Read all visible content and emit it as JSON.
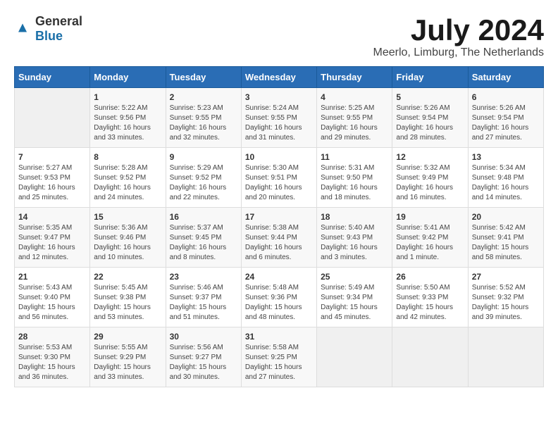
{
  "logo": {
    "text_general": "General",
    "text_blue": "Blue"
  },
  "title": "July 2024",
  "subtitle": "Meerlo, Limburg, The Netherlands",
  "days_of_week": [
    "Sunday",
    "Monday",
    "Tuesday",
    "Wednesday",
    "Thursday",
    "Friday",
    "Saturday"
  ],
  "weeks": [
    [
      {
        "day": "",
        "sunrise": "",
        "sunset": "",
        "daylight": ""
      },
      {
        "day": "1",
        "sunrise": "Sunrise: 5:22 AM",
        "sunset": "Sunset: 9:56 PM",
        "daylight": "Daylight: 16 hours and 33 minutes."
      },
      {
        "day": "2",
        "sunrise": "Sunrise: 5:23 AM",
        "sunset": "Sunset: 9:55 PM",
        "daylight": "Daylight: 16 hours and 32 minutes."
      },
      {
        "day": "3",
        "sunrise": "Sunrise: 5:24 AM",
        "sunset": "Sunset: 9:55 PM",
        "daylight": "Daylight: 16 hours and 31 minutes."
      },
      {
        "day": "4",
        "sunrise": "Sunrise: 5:25 AM",
        "sunset": "Sunset: 9:55 PM",
        "daylight": "Daylight: 16 hours and 29 minutes."
      },
      {
        "day": "5",
        "sunrise": "Sunrise: 5:26 AM",
        "sunset": "Sunset: 9:54 PM",
        "daylight": "Daylight: 16 hours and 28 minutes."
      },
      {
        "day": "6",
        "sunrise": "Sunrise: 5:26 AM",
        "sunset": "Sunset: 9:54 PM",
        "daylight": "Daylight: 16 hours and 27 minutes."
      }
    ],
    [
      {
        "day": "7",
        "sunrise": "Sunrise: 5:27 AM",
        "sunset": "Sunset: 9:53 PM",
        "daylight": "Daylight: 16 hours and 25 minutes."
      },
      {
        "day": "8",
        "sunrise": "Sunrise: 5:28 AM",
        "sunset": "Sunset: 9:52 PM",
        "daylight": "Daylight: 16 hours and 24 minutes."
      },
      {
        "day": "9",
        "sunrise": "Sunrise: 5:29 AM",
        "sunset": "Sunset: 9:52 PM",
        "daylight": "Daylight: 16 hours and 22 minutes."
      },
      {
        "day": "10",
        "sunrise": "Sunrise: 5:30 AM",
        "sunset": "Sunset: 9:51 PM",
        "daylight": "Daylight: 16 hours and 20 minutes."
      },
      {
        "day": "11",
        "sunrise": "Sunrise: 5:31 AM",
        "sunset": "Sunset: 9:50 PM",
        "daylight": "Daylight: 16 hours and 18 minutes."
      },
      {
        "day": "12",
        "sunrise": "Sunrise: 5:32 AM",
        "sunset": "Sunset: 9:49 PM",
        "daylight": "Daylight: 16 hours and 16 minutes."
      },
      {
        "day": "13",
        "sunrise": "Sunrise: 5:34 AM",
        "sunset": "Sunset: 9:48 PM",
        "daylight": "Daylight: 16 hours and 14 minutes."
      }
    ],
    [
      {
        "day": "14",
        "sunrise": "Sunrise: 5:35 AM",
        "sunset": "Sunset: 9:47 PM",
        "daylight": "Daylight: 16 hours and 12 minutes."
      },
      {
        "day": "15",
        "sunrise": "Sunrise: 5:36 AM",
        "sunset": "Sunset: 9:46 PM",
        "daylight": "Daylight: 16 hours and 10 minutes."
      },
      {
        "day": "16",
        "sunrise": "Sunrise: 5:37 AM",
        "sunset": "Sunset: 9:45 PM",
        "daylight": "Daylight: 16 hours and 8 minutes."
      },
      {
        "day": "17",
        "sunrise": "Sunrise: 5:38 AM",
        "sunset": "Sunset: 9:44 PM",
        "daylight": "Daylight: 16 hours and 6 minutes."
      },
      {
        "day": "18",
        "sunrise": "Sunrise: 5:40 AM",
        "sunset": "Sunset: 9:43 PM",
        "daylight": "Daylight: 16 hours and 3 minutes."
      },
      {
        "day": "19",
        "sunrise": "Sunrise: 5:41 AM",
        "sunset": "Sunset: 9:42 PM",
        "daylight": "Daylight: 16 hours and 1 minute."
      },
      {
        "day": "20",
        "sunrise": "Sunrise: 5:42 AM",
        "sunset": "Sunset: 9:41 PM",
        "daylight": "Daylight: 15 hours and 58 minutes."
      }
    ],
    [
      {
        "day": "21",
        "sunrise": "Sunrise: 5:43 AM",
        "sunset": "Sunset: 9:40 PM",
        "daylight": "Daylight: 15 hours and 56 minutes."
      },
      {
        "day": "22",
        "sunrise": "Sunrise: 5:45 AM",
        "sunset": "Sunset: 9:38 PM",
        "daylight": "Daylight: 15 hours and 53 minutes."
      },
      {
        "day": "23",
        "sunrise": "Sunrise: 5:46 AM",
        "sunset": "Sunset: 9:37 PM",
        "daylight": "Daylight: 15 hours and 51 minutes."
      },
      {
        "day": "24",
        "sunrise": "Sunrise: 5:48 AM",
        "sunset": "Sunset: 9:36 PM",
        "daylight": "Daylight: 15 hours and 48 minutes."
      },
      {
        "day": "25",
        "sunrise": "Sunrise: 5:49 AM",
        "sunset": "Sunset: 9:34 PM",
        "daylight": "Daylight: 15 hours and 45 minutes."
      },
      {
        "day": "26",
        "sunrise": "Sunrise: 5:50 AM",
        "sunset": "Sunset: 9:33 PM",
        "daylight": "Daylight: 15 hours and 42 minutes."
      },
      {
        "day": "27",
        "sunrise": "Sunrise: 5:52 AM",
        "sunset": "Sunset: 9:32 PM",
        "daylight": "Daylight: 15 hours and 39 minutes."
      }
    ],
    [
      {
        "day": "28",
        "sunrise": "Sunrise: 5:53 AM",
        "sunset": "Sunset: 9:30 PM",
        "daylight": "Daylight: 15 hours and 36 minutes."
      },
      {
        "day": "29",
        "sunrise": "Sunrise: 5:55 AM",
        "sunset": "Sunset: 9:29 PM",
        "daylight": "Daylight: 15 hours and 33 minutes."
      },
      {
        "day": "30",
        "sunrise": "Sunrise: 5:56 AM",
        "sunset": "Sunset: 9:27 PM",
        "daylight": "Daylight: 15 hours and 30 minutes."
      },
      {
        "day": "31",
        "sunrise": "Sunrise: 5:58 AM",
        "sunset": "Sunset: 9:25 PM",
        "daylight": "Daylight: 15 hours and 27 minutes."
      },
      {
        "day": "",
        "sunrise": "",
        "sunset": "",
        "daylight": ""
      },
      {
        "day": "",
        "sunrise": "",
        "sunset": "",
        "daylight": ""
      },
      {
        "day": "",
        "sunrise": "",
        "sunset": "",
        "daylight": ""
      }
    ]
  ]
}
